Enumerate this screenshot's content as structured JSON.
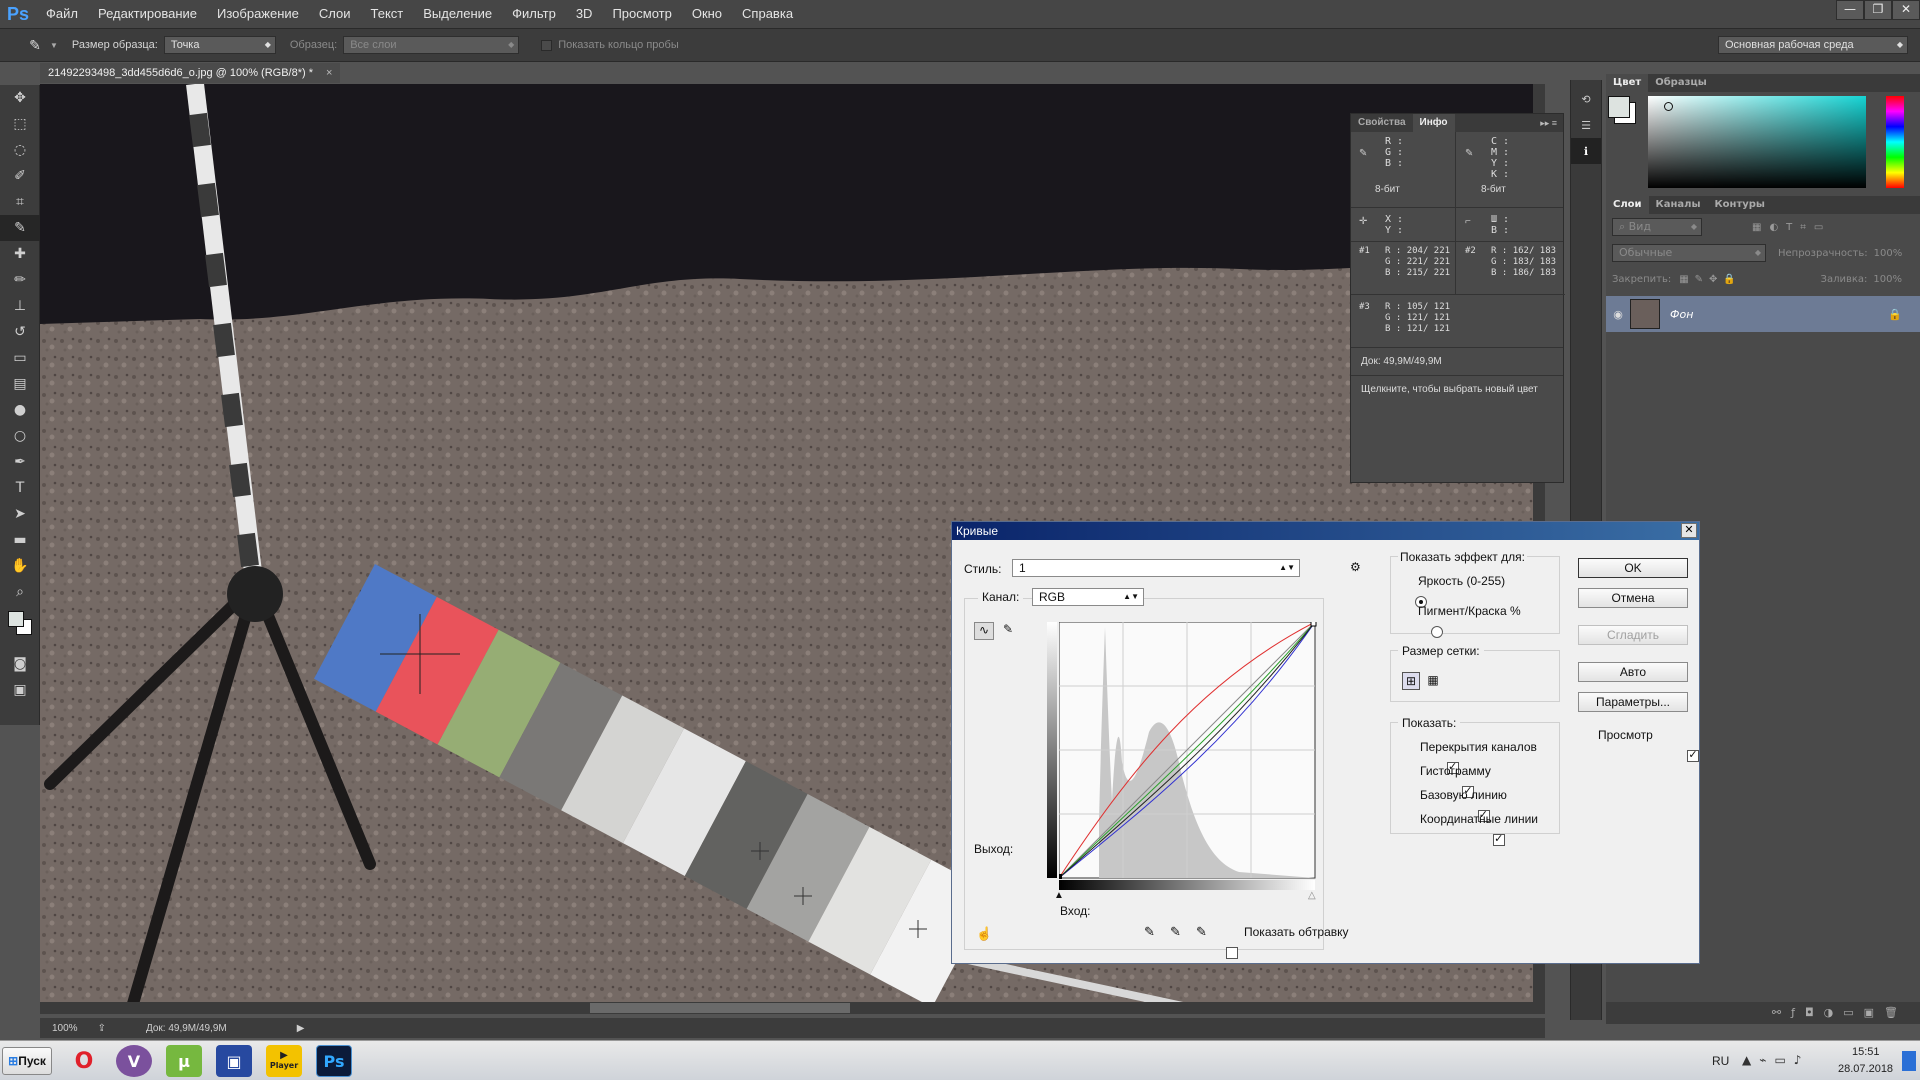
{
  "app": {
    "logo": "Ps"
  },
  "menu": [
    "Файл",
    "Редактирование",
    "Изображение",
    "Слои",
    "Текст",
    "Выделение",
    "Фильтр",
    "3D",
    "Просмотр",
    "Окно",
    "Справка"
  ],
  "window_controls": {
    "minimize": "—",
    "restore": "❐",
    "close": "✕"
  },
  "options": {
    "sample_size_label": "Размер образца:",
    "sample_size_value": "Точка",
    "sample_label": "Образец:",
    "sample_value": "Все слои",
    "show_ring_label": "Показать кольцо пробы",
    "workspace": "Основная рабочая среда"
  },
  "document": {
    "tab_title": "21492293498_3dd455d6d6_o.jpg @ 100% (RGB/8*) *",
    "tab_close": "×"
  },
  "status": {
    "zoom": "100%",
    "doc_size": "Док: 49,9M/49,9M"
  },
  "info_panel": {
    "tabs": [
      "Свойства",
      "Инфо"
    ],
    "rgb_labels": "R :\nG :\nB :",
    "cmyk_labels": "C :\nM :\nY :\nK :",
    "bit_depth_1": "8-бит",
    "bit_depth_2": "8-бит",
    "xy_labels": "X :\nY :",
    "wh_labels": "Ш :\nВ :",
    "samplers": [
      {
        "id": "#1",
        "r": "204/ 221",
        "g": "221/ 221",
        "b": "215/ 221"
      },
      {
        "id": "#2",
        "r": "162/ 183",
        "g": "183/ 183",
        "b": "186/ 183"
      },
      {
        "id": "#3",
        "r": "105/ 121",
        "g": "121/ 121",
        "b": "121/ 121"
      }
    ],
    "doc": "Док: 49,9M/49,9M",
    "hint": "Щелкните, чтобы выбрать новый цвет"
  },
  "color_panel": {
    "tabs": [
      "Цвет",
      "Образцы"
    ]
  },
  "layers_panel": {
    "tabs": [
      "Слои",
      "Каналы",
      "Контуры"
    ],
    "filter": "Вид",
    "blend": "Обычные",
    "opacity_label": "Непрозрачность:",
    "opacity": "100%",
    "lock_label": "Закрепить:",
    "fill_label": "Заливка:",
    "fill": "100%",
    "layer_name": "Фон"
  },
  "curves": {
    "title": "Кривые",
    "close": "✕",
    "preset_label": "Стиль:",
    "preset_value": "1",
    "channel_label": "Канал:",
    "channel_value": "RGB",
    "output_label": "Выход:",
    "input_label": "Вход:",
    "show_clipping": "Показать обтравку",
    "show_amount_title": "Показать эффект для:",
    "light_option": "Яркость (0-255)",
    "pigment_option": "Пигмент/Краска %",
    "grid_title": "Размер сетки:",
    "show_title": "Показать:",
    "show_options": [
      "Перекрытия каналов",
      "Гистограмму",
      "Базовую линию",
      "Координатные линии"
    ],
    "ok": "OK",
    "cancel": "Отмена",
    "smooth": "Сгладить",
    "auto": "Авто",
    "options": "Параметры...",
    "preview": "Просмотр"
  },
  "taskbar": {
    "start": "Пуск",
    "apps": [
      "O",
      "V",
      "µ",
      "▣",
      "▶",
      "Ps"
    ],
    "player_label": "Player",
    "lang": "RU",
    "time": "15:51",
    "date": "28.07.2018"
  }
}
